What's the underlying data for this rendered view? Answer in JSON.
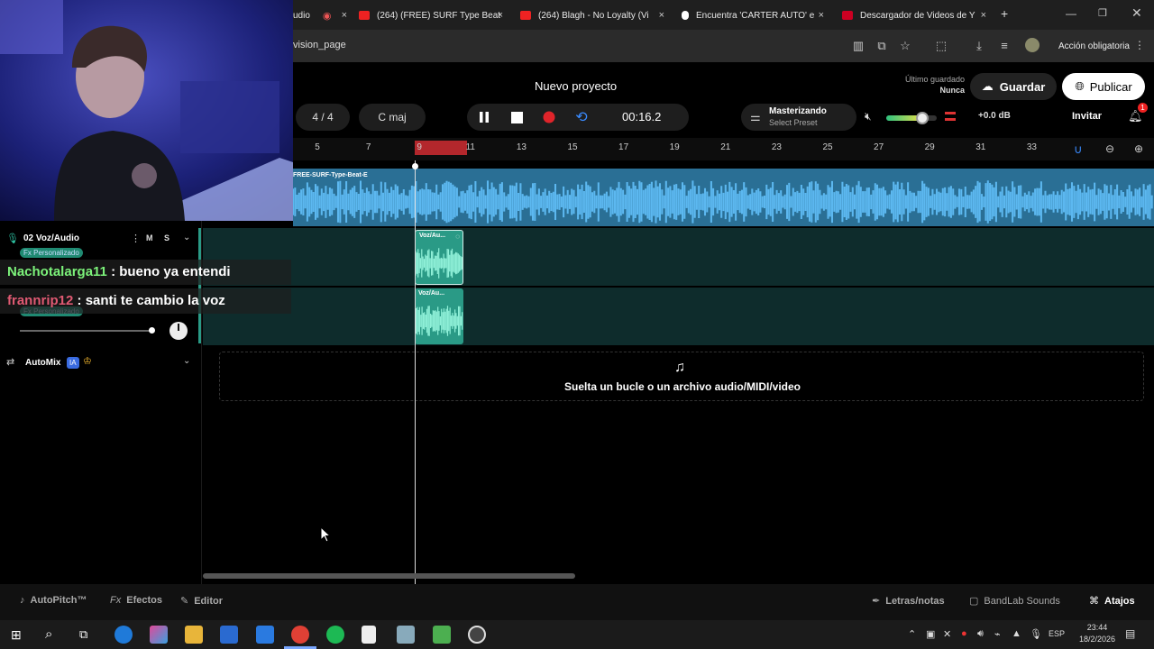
{
  "browser": {
    "tabs": [
      {
        "title": "udio",
        "fav": "#d33"
      },
      {
        "title": "(264) (FREE) SURF Type Beat",
        "fav": "#e22"
      },
      {
        "title": "(264) Blagh - No Loyalty (Vi",
        "fav": "#e22"
      },
      {
        "title": "Encuentra 'CARTER AUTO' e",
        "fav": "#222"
      },
      {
        "title": "Descargador de Videos de Y",
        "fav": "#c02"
      }
    ],
    "close": "×",
    "new_tab": "+",
    "url": "vision_page",
    "action_label": "Acción obligatoria"
  },
  "app": {
    "title": "Nuevo proyecto",
    "last_saved_label": "Último guardado",
    "last_saved_value": "Nunca",
    "save_label": "Guardar",
    "publish_label": "Publicar",
    "time_signature": "4 / 4",
    "key": "C maj",
    "time": "00:16.2",
    "mastering_title": "Masterizando",
    "mastering_preset": "Select Preset",
    "gain": "+0.0 dB",
    "invite_label": "Invitar",
    "notif_count": "1",
    "volume_level": 0.72,
    "accent": "#2a9a86"
  },
  "ruler": {
    "labels": [
      "5",
      "7",
      "9",
      "11",
      "13",
      "15",
      "17",
      "19",
      "21",
      "23",
      "25",
      "27",
      "29",
      "31",
      "33"
    ]
  },
  "tracks": {
    "beat_name": "FREE-SURF-Type-Beat-E",
    "track2_name": "02  Voz/Audio",
    "mute_label": "M",
    "solo_label": "S",
    "fx_label": "Fx Personalizado",
    "clip1_label": "Voz/Au...",
    "clip2_label": "Voz/Au...",
    "automix_label": "AutoMix",
    "ia_label": "IA"
  },
  "drop": {
    "text": "Suelta un bucle o un archivo audio/MIDI/video"
  },
  "chat": [
    {
      "user": "Nachotalarga11",
      "msg": ": bueno ya entendi",
      "color": "#7cf27a"
    },
    {
      "user": "frannrip12",
      "msg": ": santi te cambio la voz",
      "color": "#e05a73"
    }
  ],
  "bottom": {
    "autopitch": "AutoPitch™",
    "effects": "Efectos",
    "editor": "Editor",
    "lyrics": "Letras/notas",
    "sounds": "BandLab Sounds",
    "shortcuts": "Atajos"
  },
  "taskbar": {
    "lang": "ESP",
    "time": "23:44",
    "date": "18/2/2026"
  }
}
